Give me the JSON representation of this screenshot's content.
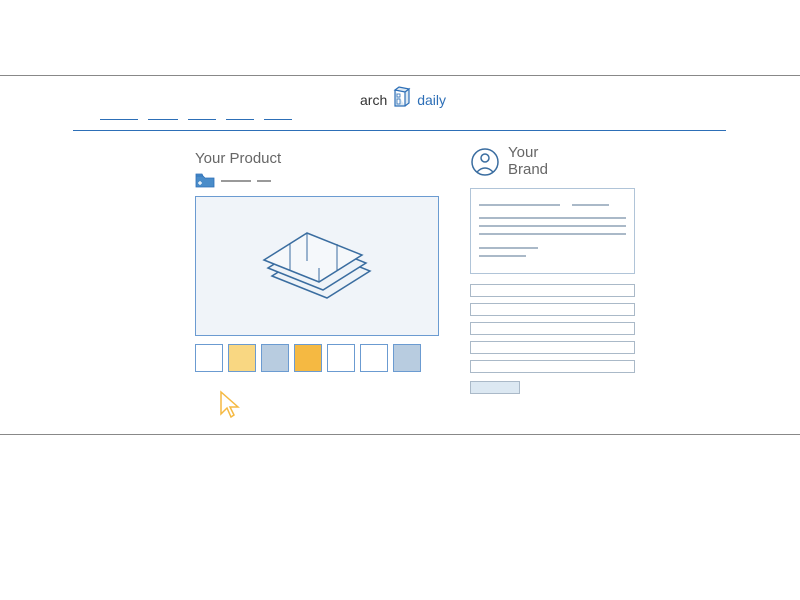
{
  "logo": {
    "text_left": "arch",
    "text_right": "daily"
  },
  "left": {
    "title": "Your Product",
    "swatch_colors": [
      "white",
      "lightyellow",
      "blue",
      "orange",
      "white",
      "white",
      "blue"
    ]
  },
  "right": {
    "title": "Your\nBrand"
  }
}
